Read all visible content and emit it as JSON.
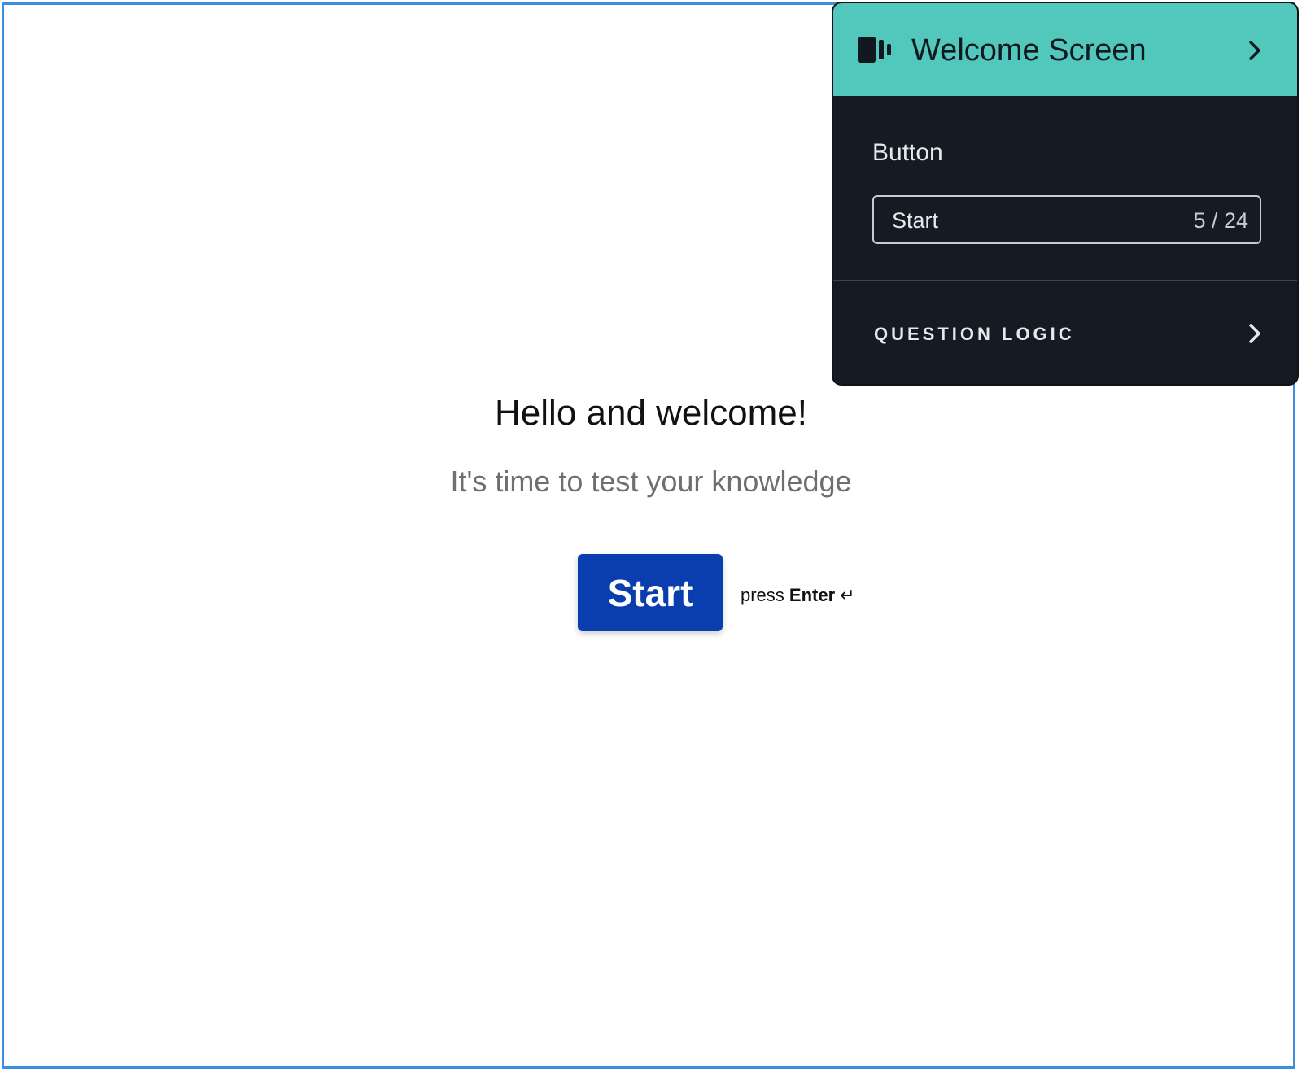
{
  "welcome": {
    "heading": "Hello and welcome!",
    "subtitle": "It's time to test your knowledge",
    "button_label": "Start",
    "hint_prefix": "press ",
    "hint_key": "Enter",
    "hint_icon": "↵"
  },
  "panel": {
    "title": "Welcome Screen",
    "title_icon": "screen-layout-icon",
    "button_field": {
      "label": "Button",
      "value": "Start",
      "char_count": "5 / 24"
    },
    "question_logic_label": "QUESTION LOGIC"
  },
  "colors": {
    "frame_border": "#3d8de0",
    "start_button": "#0a3eae",
    "panel_header": "#51c8bb",
    "panel_background": "#141b22"
  }
}
